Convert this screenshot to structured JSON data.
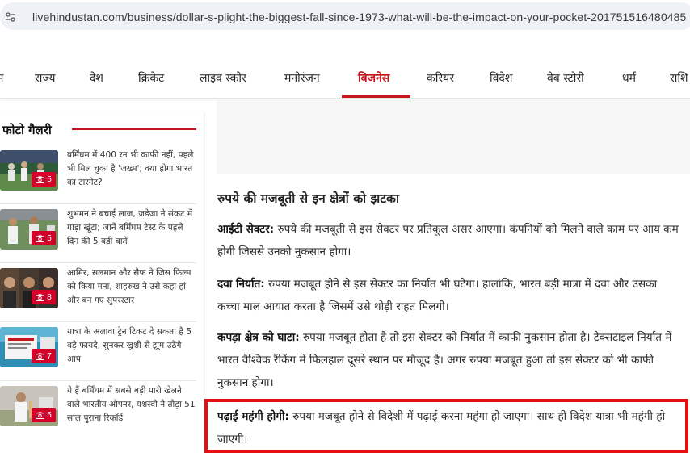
{
  "browser": {
    "url": "livehindustan.com/business/dollar-s-plight-the-biggest-fall-since-1973-what-will-be-the-impact-on-your-pocket-201751516480485"
  },
  "nav": {
    "items": [
      {
        "label": "म"
      },
      {
        "label": "राज्य"
      },
      {
        "label": "देश"
      },
      {
        "label": "क्रिकेट"
      },
      {
        "label": "लाइव स्कोर"
      },
      {
        "label": "मनोरंजन"
      },
      {
        "label": "बिजनेस"
      },
      {
        "label": "करियर"
      },
      {
        "label": "विदेश"
      },
      {
        "label": "वेब स्टोरी"
      },
      {
        "label": "धर्म"
      },
      {
        "label": "राशि"
      }
    ],
    "active_color": "#c4161c"
  },
  "gallery": {
    "title": "फोटो गैलरी",
    "items": [
      {
        "text": "बर्मिंघम में 400 रन भी काफी नहीं, पहले भी मिल चुका है 'जख्म'; क्या होगा भारत का टारगेट?",
        "count": "5"
      },
      {
        "text": "शुभमन ने बचाई लाज, जडेजा ने संकट में गाड़ा खूंटा; जानें बर्मिंघम टेस्ट के पहले दिन की 5 बड़ी बातें",
        "count": "5"
      },
      {
        "text": "आमिर, सलमान और सैफ ने जिस फिल्म को किया मना, शाहरुख ने उसे कहा हां और बन गए सुपरस्टार",
        "count": "8"
      },
      {
        "text": "यात्रा के अलावा ट्रेन टिकट दे सकता है 5 बड़े फायदे, सुनकर खुशी से झूम उठेंगे आप",
        "count": "7"
      },
      {
        "text": "ये हैं बर्मिंघम में सबसे बड़ी पारी खेलने वाले भारतीय ओपनर, यशस्वी ने तोड़ा 51 साल पुराना रिकॉर्ड",
        "count": "5"
      }
    ]
  },
  "article": {
    "heading": "रुपये की मजबूती से इन क्षेत्रों को झटका",
    "paragraphs": [
      {
        "label": "आईटी सेक्टर:",
        "text": " रुपये की मजबूती से इस सेक्टर पर प्रतिकूल असर आएगा। कंपनियों को मिलने वाले काम पर आय कम होगी जिससे उनको नुकसान होगा।"
      },
      {
        "label": "दवा निर्यात:",
        "text": " रुपया मजबूत होने से इस सेक्टर का निर्यात भी घटेगा। हालांकि, भारत बड़ी मात्रा में दवा और उसका कच्चा माल आयात करता है जिसमें उसे थोड़ी राहत मिलगी।"
      },
      {
        "label": "कपड़ा क्षेत्र को घाटा:",
        "text": " रुपया मजबूत होता है तो इस सेक्टर को निर्यात में काफी नुकसान होता है। टेक्सटाइल निर्यात में भारत वैश्विक रैंकिंग में फिलहाल दूसरे स्थान पर मौजूद है। अगर रुपया मजबूत हुआ तो इस सेक्टर को भी काफी नुकसान होगा।"
      },
      {
        "label": "पढ़ाई महंगी होगी:",
        "text": " रुपया मजबूत होने से विदेशी में पढ़ाई करना महंगा हो जाएगा। साथ ही विदेश यात्रा भी महंगी हो जाएगी।"
      }
    ],
    "highlight_color": "#e31212"
  }
}
